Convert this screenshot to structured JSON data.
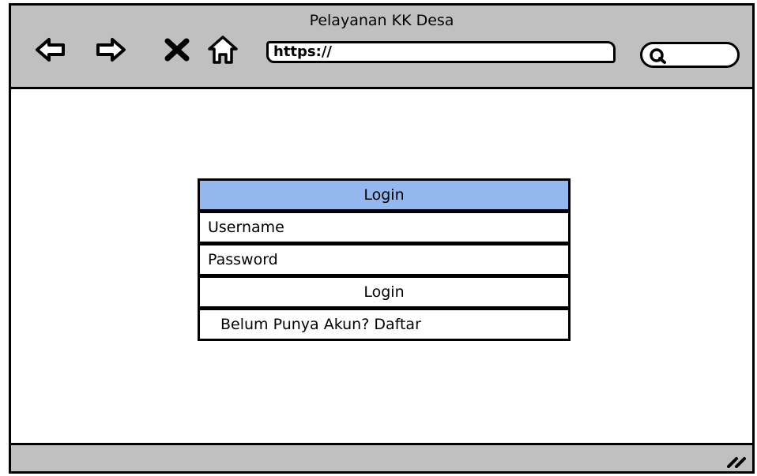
{
  "window": {
    "title": "Pelayanan KK Desa"
  },
  "toolbar": {
    "back_icon": "back-arrow-icon",
    "forward_icon": "forward-arrow-icon",
    "close_icon": "close-icon",
    "home_icon": "home-icon",
    "url": "https://",
    "search_icon": "search-icon"
  },
  "login": {
    "header": "Login",
    "username_placeholder": "Username",
    "password_placeholder": "Password",
    "submit_label": "Login",
    "register_link": "Belum Punya Akun? Daftar"
  },
  "colors": {
    "chrome": "#c0c0c0",
    "header_bg": "#94b8ee",
    "border": "#000000"
  }
}
